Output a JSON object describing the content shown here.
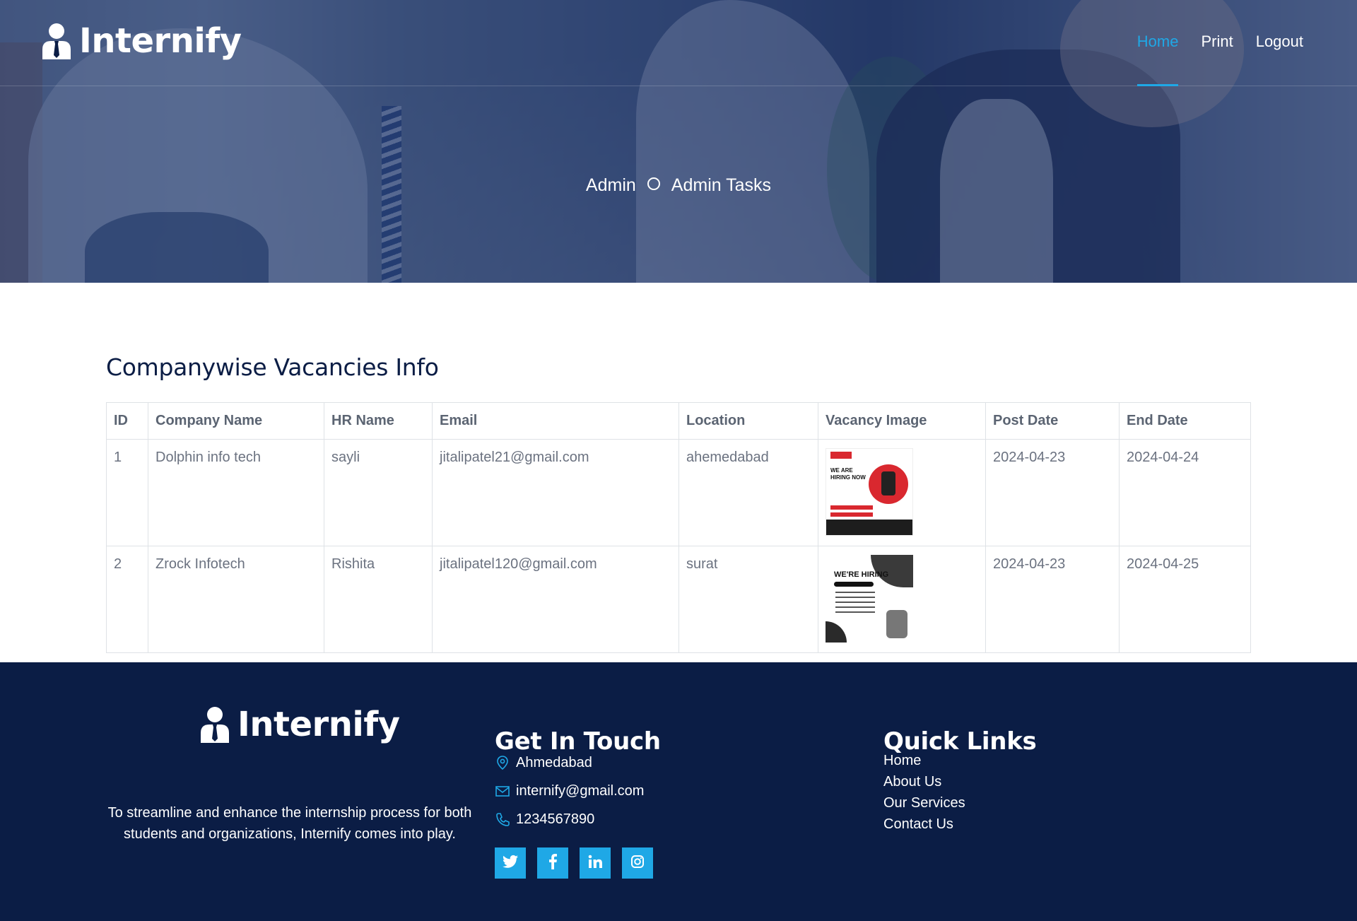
{
  "brand": {
    "name": "Internify"
  },
  "nav": [
    {
      "label": "Home",
      "active": true
    },
    {
      "label": "Print",
      "active": false
    },
    {
      "label": "Logout",
      "active": false
    }
  ],
  "breadcrumb": {
    "root": "Admin",
    "current": "Admin Tasks"
  },
  "page": {
    "title": "Companywise Vacancies Info"
  },
  "table": {
    "headers": [
      "ID",
      "Company Name",
      "HR Name",
      "Email",
      "Location",
      "Vacancy Image",
      "Post Date",
      "End Date"
    ],
    "rows": [
      {
        "id": "1",
        "company": "Dolphin info tech",
        "hr": "sayli",
        "email": "jitalipatel21@gmail.com",
        "location": "ahemedabad",
        "image_text": "WE ARE HIRING NOW",
        "post_date": "2024-04-23",
        "end_date": "2024-04-24"
      },
      {
        "id": "2",
        "company": "Zrock Infotech",
        "hr": "Rishita",
        "email": "jitalipatel120@gmail.com",
        "location": "surat",
        "image_text": "WE'RE HIRING",
        "post_date": "2024-04-23",
        "end_date": "2024-04-25"
      }
    ]
  },
  "footer": {
    "about": "To streamline and enhance the internship process for both students and organizations, Internify comes into play.",
    "get_in_touch": {
      "title": "Get In Touch",
      "address": "Ahmedabad",
      "email": "internify@gmail.com",
      "phone": "1234567890"
    },
    "quick_links": {
      "title": "Quick Links",
      "items": [
        "Home",
        "About Us",
        "Our Services",
        "Contact Us"
      ]
    },
    "social": [
      "twitter-icon",
      "facebook-icon",
      "linkedin-icon",
      "instagram-icon"
    ]
  },
  "colors": {
    "accent": "#1fa8e6",
    "navy": "#0b1d45",
    "text_muted": "#6b7280"
  }
}
